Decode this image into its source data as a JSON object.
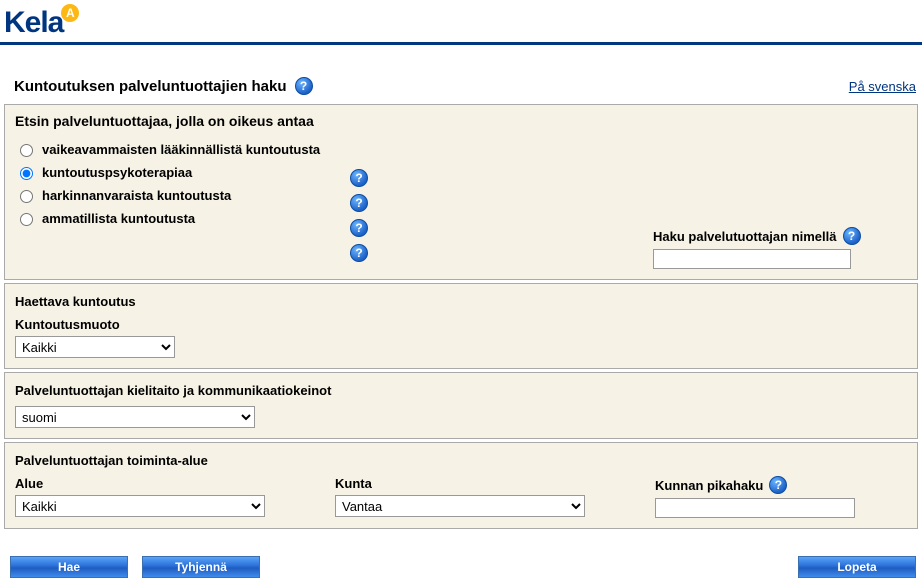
{
  "header": {
    "logo_text": "Kela",
    "logo_badge": "A"
  },
  "title": "Kuntoutuksen palveluntuottajien haku",
  "lang_link": "På svenska",
  "panel1": {
    "title": "Etsin palveluntuottajaa, jolla on oikeus antaa",
    "options": [
      {
        "label": "vaikeavammaisten lääkinnällistä kuntoutusta",
        "checked": false
      },
      {
        "label": "kuntoutuspsykoterapiaa",
        "checked": true
      },
      {
        "label": "harkinnanvaraista kuntoutusta",
        "checked": false
      },
      {
        "label": "ammatillista kuntoutusta",
        "checked": false
      }
    ],
    "name_search_label": "Haku palvelutuottajan nimellä",
    "name_search_value": ""
  },
  "panel2": {
    "title": "Haettava kuntoutus",
    "field_label": "Kuntoutusmuoto",
    "select_value": "Kaikki"
  },
  "panel3": {
    "title": "Palveluntuottajan kielitaito ja kommunikaatiokeinot",
    "select_value": "suomi"
  },
  "panel4": {
    "title": "Palveluntuottajan toiminta-alue",
    "alue_label": "Alue",
    "alue_value": "Kaikki",
    "kunta_label": "Kunta",
    "kunta_value": "Vantaa",
    "pikahaku_label": "Kunnan pikahaku",
    "pikahaku_value": ""
  },
  "buttons": {
    "hae": "Hae",
    "tyhjenna": "Tyhjennä",
    "lopeta": "Lopeta"
  },
  "help_glyph": "?"
}
